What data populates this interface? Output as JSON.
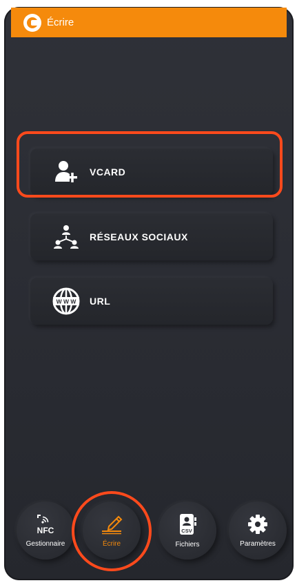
{
  "appbar": {
    "title": "Écrire",
    "color": "#f58a0c",
    "logo_icon": "app-logo-icon"
  },
  "menu": [
    {
      "id": "vcard",
      "label": "VCARD",
      "icon": "add-user-icon"
    },
    {
      "id": "reseaux-sociaux",
      "label": "RÉSEAUX SOCIAUX",
      "icon": "social-network-icon"
    },
    {
      "id": "url",
      "label": "URL",
      "icon": "globe-www-icon"
    }
  ],
  "bottom_nav": {
    "items": [
      {
        "id": "gestionnaire",
        "label": "Gestionnaire",
        "icon": "nfc-icon",
        "icon_text": "NFC",
        "active": false
      },
      {
        "id": "ecrire",
        "label": "Écrire",
        "icon": "pen-write-icon",
        "active": true
      },
      {
        "id": "fichiers",
        "label": "Fichiers",
        "icon": "csv-file-icon",
        "icon_text": "CSV",
        "active": false
      },
      {
        "id": "parametres",
        "label": "Paramètres",
        "icon": "gear-icon",
        "active": false
      }
    ],
    "active_color": "#f58a0c"
  },
  "annotations": {
    "highlight_color": "#ff4a1c",
    "highlighted": [
      "vcard",
      "ecrire"
    ]
  }
}
